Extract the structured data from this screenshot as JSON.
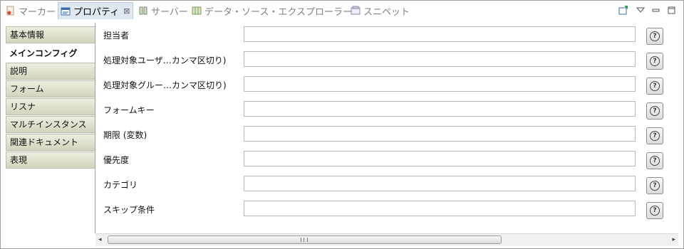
{
  "tabs": [
    {
      "label": "マーカー",
      "icon": "marker-icon",
      "active": false
    },
    {
      "label": "プロパティ",
      "icon": "properties-icon",
      "active": true,
      "close": "⊠"
    },
    {
      "label": "サーバー",
      "icon": "server-icon",
      "active": false
    },
    {
      "label": "データ・ソース・エクスプローラー",
      "icon": "data-source-icon",
      "active": false
    },
    {
      "label": "スニペット",
      "icon": "snippet-icon",
      "active": false
    }
  ],
  "sidebar": {
    "items": [
      {
        "label": "基本情報"
      },
      {
        "label": "メインコンフィグ",
        "selected": true
      },
      {
        "label": "説明"
      },
      {
        "label": "フォーム"
      },
      {
        "label": "リスナ"
      },
      {
        "label": "マルチインスタンス"
      },
      {
        "label": "関連ドキュメント"
      },
      {
        "label": "表現"
      }
    ]
  },
  "form": {
    "rows": [
      {
        "label": "担当者",
        "value": ""
      },
      {
        "label": "処理対象ユーザ…カンマ区切り)",
        "value": ""
      },
      {
        "label": "処理対象グルー…カンマ区切り)",
        "value": ""
      },
      {
        "label": "フォームキー",
        "value": ""
      },
      {
        "label": "期限 (変数)",
        "value": ""
      },
      {
        "label": "優先度",
        "value": ""
      },
      {
        "label": "カテゴリ",
        "value": ""
      },
      {
        "label": "スキップ条件",
        "value": ""
      }
    ],
    "help_glyph": "?"
  },
  "scrollbar": {
    "left_arrow": "◂",
    "right_arrow": "▸"
  }
}
